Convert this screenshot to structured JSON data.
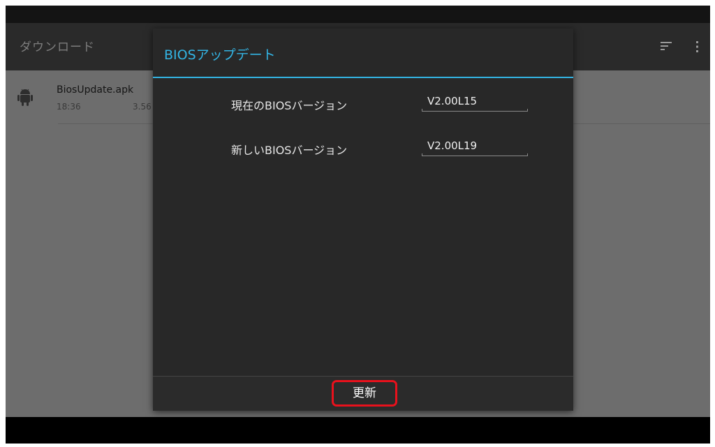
{
  "colors": {
    "accent": "#33b5e5",
    "highlight_border": "#e8111c",
    "dialog_bg": "#282828",
    "actionbar_bg": "#2a2a2a",
    "list_bg": "#6d6d6d"
  },
  "app": {
    "title": "ダウンロード",
    "actions": {
      "sort_icon": "sort-icon",
      "overflow_icon": "overflow-menu-icon"
    }
  },
  "download_list": {
    "items": [
      {
        "icon": "android-icon",
        "name": "BiosUpdate.apk",
        "time": "18:36",
        "size": "3.56"
      }
    ]
  },
  "dialog": {
    "title": "BIOSアップデート",
    "rows": [
      {
        "label": "現在のBIOSバージョン",
        "value": "V2.00L15"
      },
      {
        "label": "新しいBIOSバージョン",
        "value": "V2.00L19"
      }
    ],
    "button_label": "更新"
  }
}
